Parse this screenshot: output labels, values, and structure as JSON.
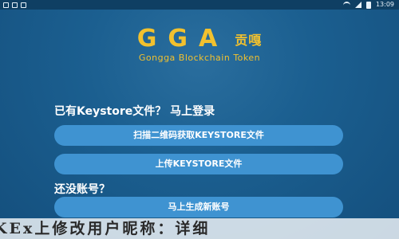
{
  "status_bar": {
    "time": "13:09",
    "icons": [
      "notification-box-icon",
      "notification-box-icon",
      "notification-box-icon",
      "signal-icon",
      "wifi-icon",
      "battery-icon"
    ]
  },
  "logo": {
    "title": "GGA",
    "cn": "贡嘎",
    "subtitle": "Gongga Blockchain Token",
    "color": "#f2c12e"
  },
  "keystore_section": {
    "label": "已有Keystore文件？ 马上登录",
    "scan_button": "扫描二维码获取KEYSTORE文件",
    "upload_button": "上传KEYSTORE文件"
  },
  "register_section": {
    "label": "还没账号？",
    "create_button": "马上生成新账号"
  },
  "overlay": {
    "text": "KEx上修改用户昵称：详细"
  },
  "colors": {
    "background": "#1b5f90",
    "button": "#3f93d1",
    "accent": "#f2c12e"
  }
}
